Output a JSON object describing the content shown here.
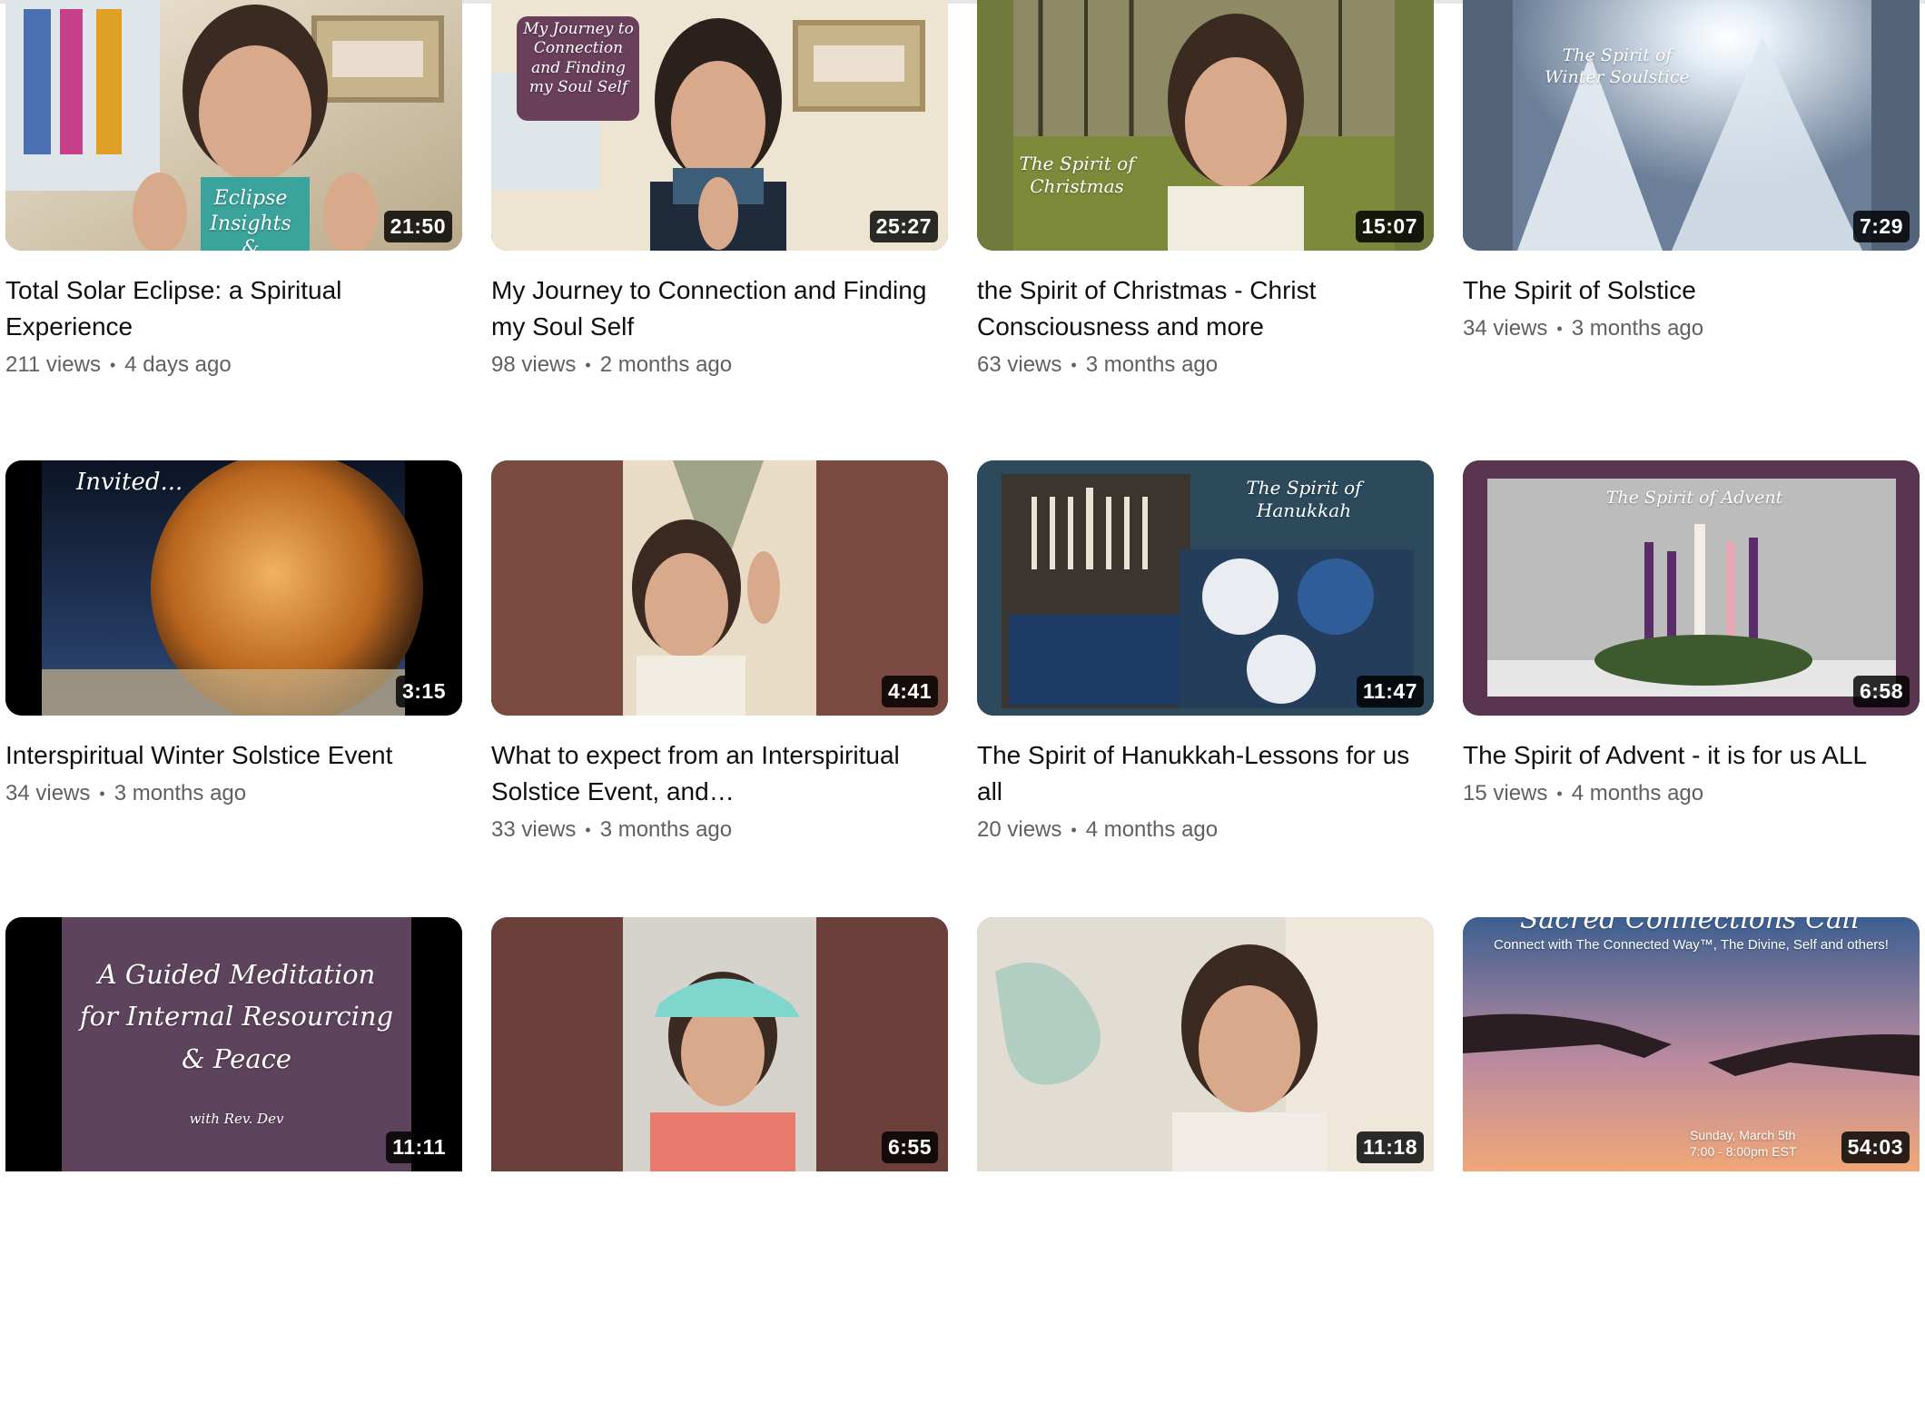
{
  "videos": [
    {
      "title": "Total Solar Eclipse: a Spiritual Experience",
      "views": "211 views",
      "age": "4 days ago",
      "duration": "21:50",
      "overlay": "Eclipse Insights\n& Opportunities",
      "bg": [
        "#d8c7a8",
        "#7c6a4e"
      ]
    },
    {
      "title": "My Journey to Connection and Finding my Soul Self",
      "views": "98 views",
      "age": "2 months ago",
      "duration": "25:27",
      "overlay": "My Journey to\nConnection\nand Finding\nmy Soul Self",
      "bg": [
        "#e4d8c2",
        "#8c7a62"
      ]
    },
    {
      "title": "the Spirit of Christmas - Christ Consciousness and more",
      "views": "63 views",
      "age": "3 months ago",
      "duration": "15:07",
      "overlay": "The Spirit of\nChristmas",
      "bg": [
        "#6f7a3c",
        "#b5a56a"
      ]
    },
    {
      "title": "The Spirit of Solstice",
      "views": "34 views",
      "age": "3 months ago",
      "duration": "7:29",
      "overlay": "The Spirit of\nWinter Soulstice",
      "bg": [
        "#52637a",
        "#c9d6e4"
      ]
    },
    {
      "title": "Interspiritual Winter Solstice Event",
      "views": "34 views",
      "age": "3 months ago",
      "duration": "3:15",
      "overlay": "Invited...",
      "bg": [
        "#0a0a0a",
        "#c8782e"
      ]
    },
    {
      "title": "What to expect from an Interspiritual Solstice Event, and…",
      "views": "33 views",
      "age": "3 months ago",
      "duration": "4:41",
      "overlay": "",
      "bg": [
        "#7a4a40",
        "#e9dcc6"
      ]
    },
    {
      "title": "The Spirit of Hanukkah-Lessons for us all",
      "views": "20 views",
      "age": "4 months ago",
      "duration": "11:47",
      "overlay": "The Spirit of\nHanukkah",
      "bg": [
        "#2c4a5c",
        "#7e8e97"
      ]
    },
    {
      "title": "The Spirit of Advent - it is for us ALL",
      "views": "15 views",
      "age": "4 months ago",
      "duration": "6:58",
      "overlay": "The Spirit of Advent",
      "bg": [
        "#5a3550",
        "#b8b8b8"
      ]
    },
    {
      "title": "",
      "views": "",
      "age": "",
      "duration": "11:11",
      "overlay": "A Guided Meditation\nfor Internal Resourcing\n& Peace",
      "overlay_small": "with Rev. Dev",
      "bg": [
        "#0a0a0a",
        "#5e435c"
      ]
    },
    {
      "title": "",
      "views": "",
      "age": "",
      "duration": "6:55",
      "overlay": "",
      "bg": [
        "#6b3f3a",
        "#e9d6c8"
      ]
    },
    {
      "title": "",
      "views": "",
      "age": "",
      "duration": "11:18",
      "overlay": "",
      "bg": [
        "#dcd8cf",
        "#8a6a4a"
      ]
    },
    {
      "title": "",
      "views": "",
      "age": "",
      "duration": "54:03",
      "overlay": "Sacred Connections Call",
      "overlay_small": "Connect with The Connected Way™, The Divine, Self and others!",
      "overlay_date": "Sunday, March 5th\n7:00 - 8:00pm EST",
      "bg": [
        "#3a5a8a",
        "#e9a07a"
      ]
    }
  ],
  "colors": {
    "title": "#0f0f0f",
    "meta": "#606060",
    "duration_bg": "#000000"
  }
}
